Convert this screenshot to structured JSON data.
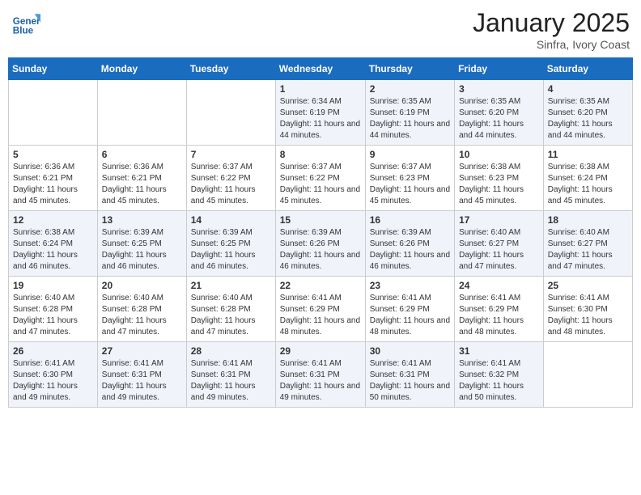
{
  "logo": {
    "general": "General",
    "blue": "Blue"
  },
  "title": {
    "month": "January 2025",
    "location": "Sinfra, Ivory Coast"
  },
  "days_of_week": [
    "Sunday",
    "Monday",
    "Tuesday",
    "Wednesday",
    "Thursday",
    "Friday",
    "Saturday"
  ],
  "weeks": [
    [
      {
        "day": "",
        "info": ""
      },
      {
        "day": "",
        "info": ""
      },
      {
        "day": "",
        "info": ""
      },
      {
        "day": "1",
        "info": "Sunrise: 6:34 AM\nSunset: 6:19 PM\nDaylight: 11 hours and 44 minutes."
      },
      {
        "day": "2",
        "info": "Sunrise: 6:35 AM\nSunset: 6:19 PM\nDaylight: 11 hours and 44 minutes."
      },
      {
        "day": "3",
        "info": "Sunrise: 6:35 AM\nSunset: 6:20 PM\nDaylight: 11 hours and 44 minutes."
      },
      {
        "day": "4",
        "info": "Sunrise: 6:35 AM\nSunset: 6:20 PM\nDaylight: 11 hours and 44 minutes."
      }
    ],
    [
      {
        "day": "5",
        "info": "Sunrise: 6:36 AM\nSunset: 6:21 PM\nDaylight: 11 hours and 45 minutes."
      },
      {
        "day": "6",
        "info": "Sunrise: 6:36 AM\nSunset: 6:21 PM\nDaylight: 11 hours and 45 minutes."
      },
      {
        "day": "7",
        "info": "Sunrise: 6:37 AM\nSunset: 6:22 PM\nDaylight: 11 hours and 45 minutes."
      },
      {
        "day": "8",
        "info": "Sunrise: 6:37 AM\nSunset: 6:22 PM\nDaylight: 11 hours and 45 minutes."
      },
      {
        "day": "9",
        "info": "Sunrise: 6:37 AM\nSunset: 6:23 PM\nDaylight: 11 hours and 45 minutes."
      },
      {
        "day": "10",
        "info": "Sunrise: 6:38 AM\nSunset: 6:23 PM\nDaylight: 11 hours and 45 minutes."
      },
      {
        "day": "11",
        "info": "Sunrise: 6:38 AM\nSunset: 6:24 PM\nDaylight: 11 hours and 45 minutes."
      }
    ],
    [
      {
        "day": "12",
        "info": "Sunrise: 6:38 AM\nSunset: 6:24 PM\nDaylight: 11 hours and 46 minutes."
      },
      {
        "day": "13",
        "info": "Sunrise: 6:39 AM\nSunset: 6:25 PM\nDaylight: 11 hours and 46 minutes."
      },
      {
        "day": "14",
        "info": "Sunrise: 6:39 AM\nSunset: 6:25 PM\nDaylight: 11 hours and 46 minutes."
      },
      {
        "day": "15",
        "info": "Sunrise: 6:39 AM\nSunset: 6:26 PM\nDaylight: 11 hours and 46 minutes."
      },
      {
        "day": "16",
        "info": "Sunrise: 6:39 AM\nSunset: 6:26 PM\nDaylight: 11 hours and 46 minutes."
      },
      {
        "day": "17",
        "info": "Sunrise: 6:40 AM\nSunset: 6:27 PM\nDaylight: 11 hours and 47 minutes."
      },
      {
        "day": "18",
        "info": "Sunrise: 6:40 AM\nSunset: 6:27 PM\nDaylight: 11 hours and 47 minutes."
      }
    ],
    [
      {
        "day": "19",
        "info": "Sunrise: 6:40 AM\nSunset: 6:28 PM\nDaylight: 11 hours and 47 minutes."
      },
      {
        "day": "20",
        "info": "Sunrise: 6:40 AM\nSunset: 6:28 PM\nDaylight: 11 hours and 47 minutes."
      },
      {
        "day": "21",
        "info": "Sunrise: 6:40 AM\nSunset: 6:28 PM\nDaylight: 11 hours and 47 minutes."
      },
      {
        "day": "22",
        "info": "Sunrise: 6:41 AM\nSunset: 6:29 PM\nDaylight: 11 hours and 48 minutes."
      },
      {
        "day": "23",
        "info": "Sunrise: 6:41 AM\nSunset: 6:29 PM\nDaylight: 11 hours and 48 minutes."
      },
      {
        "day": "24",
        "info": "Sunrise: 6:41 AM\nSunset: 6:29 PM\nDaylight: 11 hours and 48 minutes."
      },
      {
        "day": "25",
        "info": "Sunrise: 6:41 AM\nSunset: 6:30 PM\nDaylight: 11 hours and 48 minutes."
      }
    ],
    [
      {
        "day": "26",
        "info": "Sunrise: 6:41 AM\nSunset: 6:30 PM\nDaylight: 11 hours and 49 minutes."
      },
      {
        "day": "27",
        "info": "Sunrise: 6:41 AM\nSunset: 6:31 PM\nDaylight: 11 hours and 49 minutes."
      },
      {
        "day": "28",
        "info": "Sunrise: 6:41 AM\nSunset: 6:31 PM\nDaylight: 11 hours and 49 minutes."
      },
      {
        "day": "29",
        "info": "Sunrise: 6:41 AM\nSunset: 6:31 PM\nDaylight: 11 hours and 49 minutes."
      },
      {
        "day": "30",
        "info": "Sunrise: 6:41 AM\nSunset: 6:31 PM\nDaylight: 11 hours and 50 minutes."
      },
      {
        "day": "31",
        "info": "Sunrise: 6:41 AM\nSunset: 6:32 PM\nDaylight: 11 hours and 50 minutes."
      },
      {
        "day": "",
        "info": ""
      }
    ]
  ]
}
